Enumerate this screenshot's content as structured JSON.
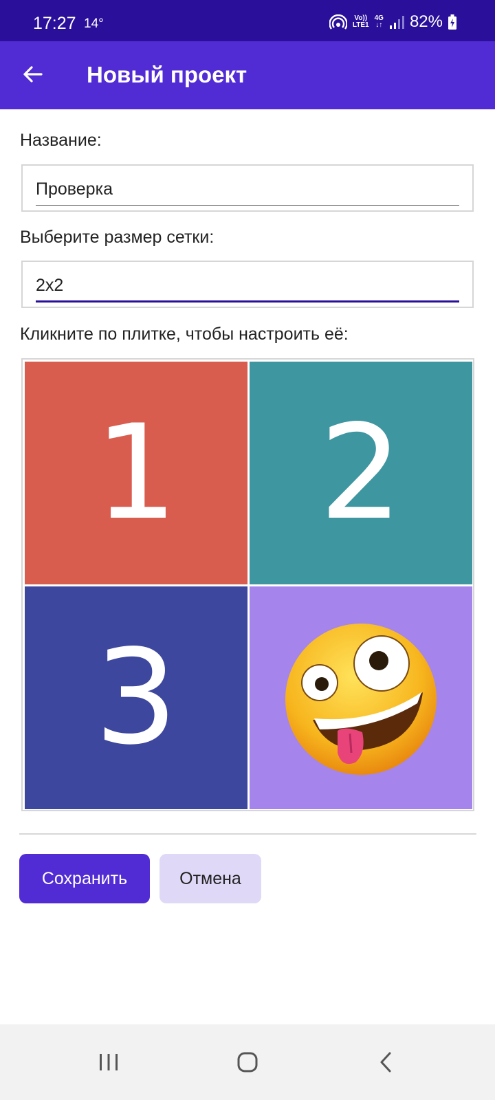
{
  "status_bar": {
    "time": "17:27",
    "temperature": "14°",
    "volte_label_top": "Vo))",
    "volte_label_bottom": "LTE1",
    "network_label_top": "4G",
    "network_label_bottom": "↓↑",
    "battery": "82%",
    "icons": [
      "hotspot-icon",
      "signal-icon",
      "battery-charging-icon"
    ]
  },
  "app_bar": {
    "title": "Новый проект",
    "back_icon": "arrow-left-icon",
    "color": "#512bd4"
  },
  "form": {
    "name_label": "Название:",
    "name_value": "Проверка",
    "grid_size_label": "Выберите размер сетки:",
    "grid_size_value": "2x2",
    "tiles_label": "Кликните по плитке, чтобы настроить её:"
  },
  "tiles": [
    {
      "label": "1",
      "color": "#d95d4f"
    },
    {
      "label": "2",
      "color": "#3e96a0"
    },
    {
      "label": "3",
      "color": "#3d479d"
    },
    {
      "label": "",
      "color": "#a584ec",
      "icon": "zany-face-emoji"
    }
  ],
  "buttons": {
    "save_label": "Сохранить",
    "cancel_label": "Отмена"
  },
  "nav_bar": {
    "icons": [
      "recent-apps-icon",
      "home-icon",
      "back-nav-icon"
    ]
  }
}
